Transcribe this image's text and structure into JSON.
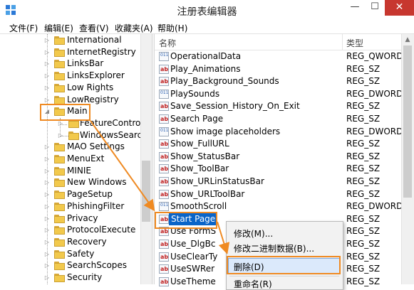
{
  "window": {
    "title": "注册表编辑器",
    "min": "—",
    "max": "☐",
    "close": "✕"
  },
  "menu": [
    "文件(F)",
    "编辑(E)",
    "查看(V)",
    "收藏夹(A)",
    "帮助(H)"
  ],
  "tree": {
    "items": [
      {
        "label": "International"
      },
      {
        "label": "InternetRegistry"
      },
      {
        "label": "LinksBar"
      },
      {
        "label": "LinksExplorer"
      },
      {
        "label": "Low Rights"
      },
      {
        "label": "LowRegistry"
      },
      {
        "label": "Main",
        "expanded": true
      },
      {
        "label": "FeatureControl",
        "child": true
      },
      {
        "label": "WindowsSearch",
        "child": true
      },
      {
        "label": "MAO Settings"
      },
      {
        "label": "MenuExt"
      },
      {
        "label": "MINIE"
      },
      {
        "label": "New Windows"
      },
      {
        "label": "PageSetup"
      },
      {
        "label": "PhishingFilter"
      },
      {
        "label": "Privacy"
      },
      {
        "label": "ProtocolExecute"
      },
      {
        "label": "Recovery"
      },
      {
        "label": "Safety"
      },
      {
        "label": "SearchScopes"
      },
      {
        "label": "Security"
      }
    ]
  },
  "values": {
    "col_name": "名称",
    "col_type": "类型",
    "rows": [
      {
        "name": "OperationalData",
        "type": "REG_QWORD",
        "icon": "binary"
      },
      {
        "name": "Play_Animations",
        "type": "REG_SZ",
        "icon": "string"
      },
      {
        "name": "Play_Background_Sounds",
        "type": "REG_SZ",
        "icon": "string"
      },
      {
        "name": "PlaySounds",
        "type": "REG_DWORD",
        "icon": "binary"
      },
      {
        "name": "Save_Session_History_On_Exit",
        "type": "REG_SZ",
        "icon": "string"
      },
      {
        "name": "Search Page",
        "type": "REG_SZ",
        "icon": "string"
      },
      {
        "name": "Show image placeholders",
        "type": "REG_DWORD",
        "icon": "binary"
      },
      {
        "name": "Show_FullURL",
        "type": "REG_SZ",
        "icon": "string"
      },
      {
        "name": "Show_StatusBar",
        "type": "REG_SZ",
        "icon": "string"
      },
      {
        "name": "Show_ToolBar",
        "type": "REG_SZ",
        "icon": "string"
      },
      {
        "name": "Show_URLinStatusBar",
        "type": "REG_SZ",
        "icon": "string"
      },
      {
        "name": "Show_URLToolBar",
        "type": "REG_SZ",
        "icon": "string"
      },
      {
        "name": "SmoothScroll",
        "type": "REG_DWORD",
        "icon": "binary"
      },
      {
        "name": "Start Page",
        "type": "REG_SZ",
        "icon": "string",
        "selected": true
      },
      {
        "name": "Use FormS",
        "type": "REG_SZ",
        "icon": "string"
      },
      {
        "name": "Use_DlgBc",
        "type": "REG_SZ",
        "icon": "string"
      },
      {
        "name": "UseClearTy",
        "type": "REG_SZ",
        "icon": "string"
      },
      {
        "name": "UseSWRer",
        "type": "REG_SZ",
        "icon": "string"
      },
      {
        "name": "UseTheme",
        "type": "REG_SZ",
        "icon": "string"
      }
    ]
  },
  "context_menu": {
    "modify": "修改(M)...",
    "modify_binary": "修改二进制数据(B)...",
    "delete": "删除(D)",
    "rename": "重命名(R)"
  },
  "colors": {
    "accent_orange": "#ef8a22",
    "selection_blue": "#0a64c8",
    "close_red": "#c7372f"
  }
}
